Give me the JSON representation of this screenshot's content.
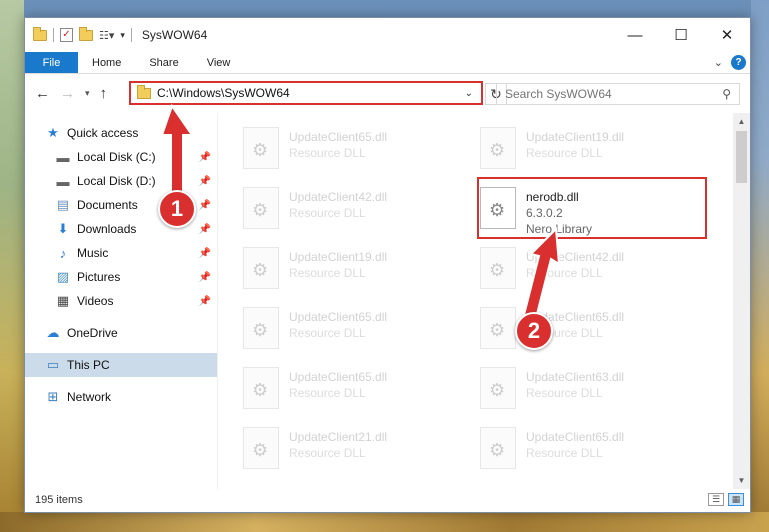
{
  "window": {
    "title": "SysWOW64",
    "controls": {
      "minimize": "—",
      "maximize": "☐",
      "close": "✕"
    }
  },
  "ribbon": {
    "file_tab": "File",
    "tabs": [
      "Home",
      "Share",
      "View"
    ]
  },
  "address": {
    "path": "C:\\Windows\\SysWOW64"
  },
  "search": {
    "placeholder": "Search SysWOW64"
  },
  "nav": {
    "quick_access": "Quick access",
    "pinned": [
      {
        "label": "Local Disk (C:)",
        "icon": "drive-icon"
      },
      {
        "label": "Local Disk (D:)",
        "icon": "drive-icon"
      },
      {
        "label": "Documents",
        "icon": "documents-icon"
      },
      {
        "label": "Downloads",
        "icon": "downloads-icon"
      },
      {
        "label": "Music",
        "icon": "music-icon"
      },
      {
        "label": "Pictures",
        "icon": "pictures-icon"
      },
      {
        "label": "Videos",
        "icon": "videos-icon"
      }
    ],
    "onedrive": "OneDrive",
    "this_pc": "This PC",
    "network": "Network"
  },
  "files": [
    {
      "name": "UpdateClient65.dll",
      "type": "Resource DLL"
    },
    {
      "name": "UpdateClient19.dll",
      "type": "Resource DLL"
    },
    {
      "name": "UpdateClient42.dll",
      "type": "Resource DLL"
    },
    {
      "name": "nerodb.dll",
      "version": "6.3.0.2",
      "type": "Nero Library",
      "focus": true
    },
    {
      "name": "UpdateClient19.dll",
      "type": "Resource DLL"
    },
    {
      "name": "UpdateClient42.dll",
      "type": "Resource DLL"
    },
    {
      "name": "UpdateClient65.dll",
      "type": "Resource DLL"
    },
    {
      "name": "UpdateClient65.dll",
      "type": "Resource DLL"
    },
    {
      "name": "UpdateClient65.dll",
      "type": "Resource DLL"
    },
    {
      "name": "UpdateClient63.dll",
      "type": "Resource DLL"
    },
    {
      "name": "UpdateClient21.dll",
      "type": "Resource DLL"
    },
    {
      "name": "UpdateClient65.dll",
      "type": "Resource DLL"
    }
  ],
  "status": {
    "item_count": "195 items"
  },
  "annotations": {
    "step1": "1",
    "step2": "2",
    "accent": "#d9302f"
  }
}
